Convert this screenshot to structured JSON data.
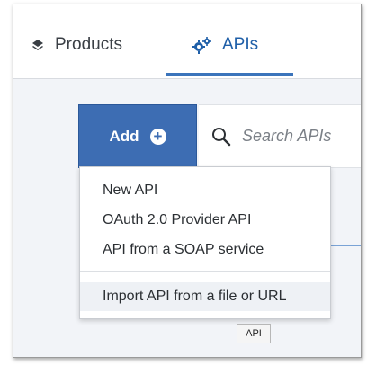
{
  "tabs": [
    {
      "label": "Products",
      "icon": "layers-icon",
      "active": false
    },
    {
      "label": "APIs",
      "icon": "gears-icon",
      "active": true
    }
  ],
  "toolbar": {
    "add_label": "Add",
    "add_icon": "plus-circle-icon",
    "search_placeholder": "Search APIs",
    "search_icon": "search-icon"
  },
  "add_menu": {
    "items": [
      {
        "label": "New API"
      },
      {
        "label": "OAuth 2.0 Provider API"
      },
      {
        "label": "API from a SOAP service"
      },
      {
        "label": "Import API from a file or URL"
      }
    ]
  },
  "tooltip": {
    "text": "API"
  },
  "colors": {
    "accent": "#3d6db3",
    "active_tab_text": "#1f5fa8",
    "tab_underline": "#3b74bb",
    "background": "#f2f4f8"
  }
}
